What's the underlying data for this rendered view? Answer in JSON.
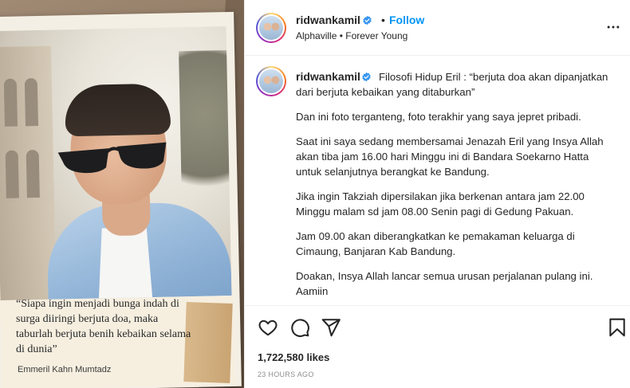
{
  "post": {
    "username": "ridwankamil",
    "follow_separator": "•",
    "follow_label": "Follow",
    "location": "Alphaville • Forever Young"
  },
  "media": {
    "quote": "“Siapa ingin menjadi bunga indah di surga diiringi berjuta doa, maka taburlah berjuta benih kebaikan selama di dunia”",
    "author": "Emmeril Kahn Mumtadz"
  },
  "caption": {
    "username": "ridwankamil",
    "paragraphs": [
      "Filosofi Hidup Eril : “berjuta doa akan dipanjatkan dari berjuta kebaikan yang ditaburkan”",
      "Dan ini foto terganteng, foto terakhir yang saya jepret pribadi.",
      "Saat ini saya sedang membersamai Jenazah Eril yang Insya Allah akan tiba jam 16.00 hari Minggu ini di Bandara Soekarno Hatta untuk selanjutnya berangkat ke Bandung.",
      "Jika ingin Takziah dipersilakan jika berkenan antara jam 22.00 Minggu malam sd jam 08.00 Senin pagi di Gedung Pakuan.",
      "Jam 09.00 akan diberangkatkan ke pemakaman keluarga di Cimaung, Banjaran Kab Bandung.",
      "Doakan, Insya Allah lancar semua urusan perjalanan pulang ini.",
      "Aamiin"
    ]
  },
  "stats": {
    "likes": "1,722,580 likes",
    "time": "23 HOURS AGO"
  },
  "icons": {
    "like": "heart-icon",
    "comment": "comment-icon",
    "share": "share-icon",
    "save": "bookmark-icon",
    "more": "more-icon",
    "verified": "verified-badge-icon"
  },
  "colors": {
    "accent": "#0095f6",
    "verified": "#3897f0",
    "muted": "#8e8e8e"
  }
}
